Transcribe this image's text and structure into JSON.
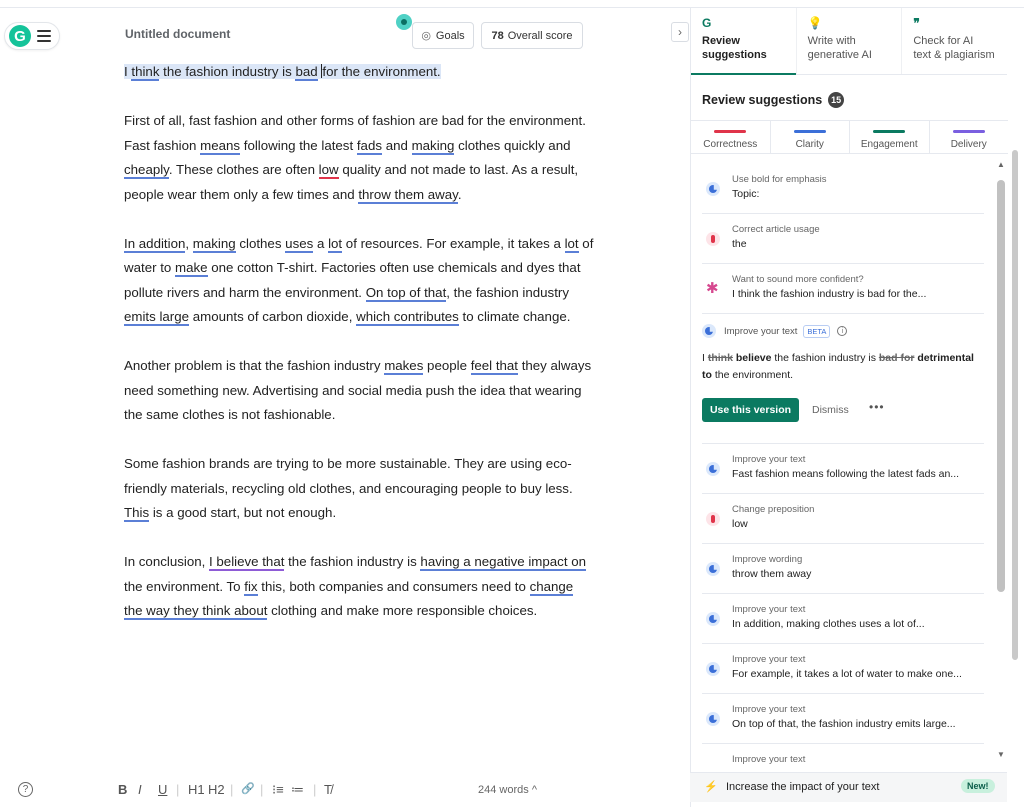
{
  "doc": {
    "title": "Untitled document",
    "goals_label": "Goals",
    "score_value": "78",
    "score_label": "Overall score",
    "word_count": "244 words"
  },
  "editor": {
    "p1": {
      "a": "I ",
      "b": "think",
      "c": " the fashion industry is ",
      "d": "bad",
      "e": "for the environment."
    },
    "p2": {
      "t1": "First of all, fast fashion and other forms of fashion are bad for the environment.",
      "t2": "Fast fashion ",
      "w1": "means",
      "t3": " following the latest ",
      "w2": "fads",
      "t4": " and ",
      "w3": "making",
      "t5": " clothes quickly and ",
      "w4": "cheaply",
      "t6": ". These clothes are often ",
      "w5": "low",
      "t7": " quality and not made to last. As a result, people wear them only a few times and ",
      "w6": "throw them away",
      "t8": "."
    },
    "p3": {
      "w1": "In addition",
      "t1": ", ",
      "w2": "making",
      "t2": " clothes ",
      "w3": "uses",
      "t3": " a ",
      "w4": "lot",
      "t4": " of resources. For example, it takes a ",
      "w5": "lot",
      "t5": " of water to ",
      "w6": "make",
      "t6": " one cotton T-shirt. Factories often use chemicals and dyes that pollute rivers and harm the environment. ",
      "w7": "On top of that",
      "t7": ", the fashion industry ",
      "w8": "emits large",
      "t8": " amounts of carbon dioxide, ",
      "w9": "which contributes",
      "t9": " to climate change."
    },
    "p4": {
      "t1": "Another problem is that the fashion industry ",
      "w1": "makes",
      "t2": " people ",
      "w2": "feel that",
      "t3": " they always need something new. Advertising and social media push the idea that wearing the same clothes is not fashionable."
    },
    "p5": {
      "t1": "Some fashion brands are trying to be more sustainable. They are using eco-friendly materials, recycling old clothes, and encouraging people to buy less. ",
      "w1": "This",
      "t2": " is a good start, but not enough."
    },
    "p6": {
      "t1": "In conclusion, ",
      "w1": "I believe that",
      "t2": " the fashion industry is ",
      "w2": "having a negative impact on",
      "t3": " the environment. To ",
      "w3": "fix",
      "t4": " this, both companies and consumers need to ",
      "w4": "change the way they think about",
      "t5": " clothing and make more responsible choices."
    }
  },
  "toolbar": {
    "help": "?",
    "bold": "B",
    "italic": "I",
    "underline": "U",
    "h1": "H1",
    "h2": "H2",
    "sep": "|",
    "link": "🔗",
    "ol": "⁝≡",
    "ul": "≔",
    "clear": "T̸",
    "chevron": "^"
  },
  "panel": {
    "tabs": [
      {
        "label1": "Review",
        "label2": "suggestions",
        "icon": "G"
      },
      {
        "label1": "Write with",
        "label2": "generative AI",
        "icon": "💡"
      },
      {
        "label1": "Check for AI",
        "label2": "text & plagiarism",
        "icon": "❞"
      }
    ],
    "review_title": "Review suggestions",
    "review_count": "15",
    "categories": [
      {
        "label": "Correctness",
        "color": "#e0344a"
      },
      {
        "label": "Clarity",
        "color": "#3b6fd8"
      },
      {
        "label": "Engagement",
        "color": "#0b7a61"
      },
      {
        "label": "Delivery",
        "color": "#7a5fe0"
      }
    ],
    "items_top": [
      {
        "label": "Use bold for emphasis",
        "text": "Topic:",
        "icon": "clarity-icon"
      },
      {
        "label": "Correct article usage",
        "text": "the",
        "icon": "correctness-icon"
      },
      {
        "label": "Want to sound more confident?",
        "text": "I think the fashion industry is bad for the...",
        "icon": "tone-icon"
      }
    ],
    "expanded": {
      "label": "Improve your text",
      "beta": "BETA",
      "info": "i",
      "b1": "I ",
      "b2": "think",
      "b3": " ",
      "b4": "believe",
      "b5": " the fashion industry is ",
      "b6": "bad for",
      "b7": " ",
      "b8": "detrimental to",
      "b9": " the environment.",
      "use_label": "Use this version",
      "dismiss_label": "Dismiss",
      "more": "•••"
    },
    "items_bottom": [
      {
        "label": "Improve your text",
        "text": "Fast fashion means following the latest fads an...",
        "icon": "clarity-icon"
      },
      {
        "label": "Change preposition",
        "text": "low",
        "icon": "correctness-icon"
      },
      {
        "label": "Improve wording",
        "text": "throw them away",
        "icon": "clarity-icon"
      },
      {
        "label": "Improve your text",
        "text": "In addition, making clothes uses a lot of...",
        "icon": "clarity-icon"
      },
      {
        "label": "Improve your text",
        "text": "For example, it takes a lot of water to make one...",
        "icon": "clarity-icon"
      },
      {
        "label": "Improve your text",
        "text": "On top of that, the fashion industry emits large...",
        "icon": "clarity-icon"
      },
      {
        "label": "Improve your text",
        "text": "",
        "icon": "clarity-icon"
      }
    ],
    "footer_text": "Increase the impact of your text",
    "footer_new": "New!",
    "scroll_up": "▲",
    "scroll_down": "▼"
  }
}
